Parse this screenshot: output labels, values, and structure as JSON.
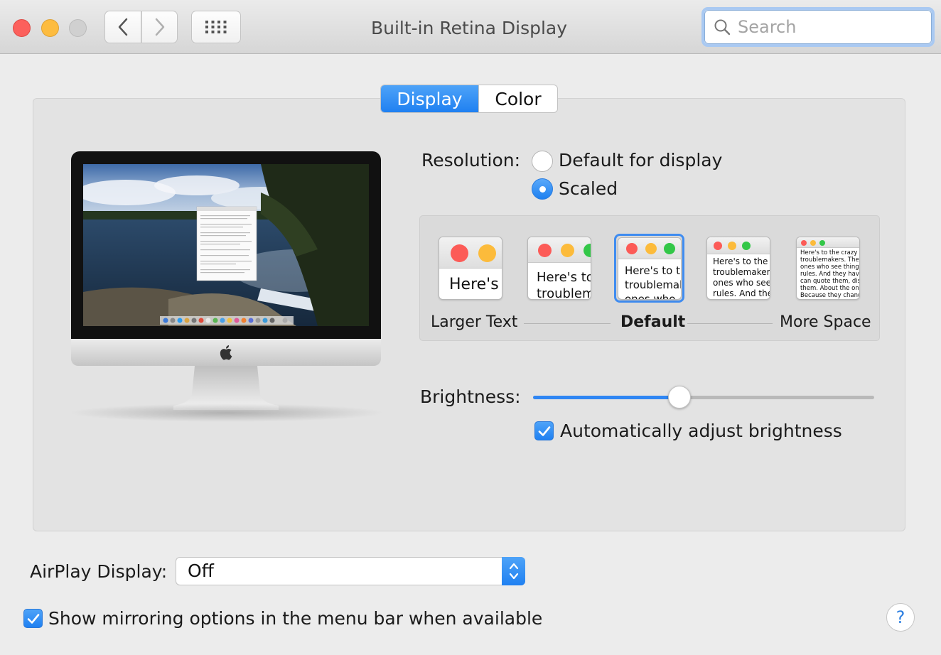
{
  "window": {
    "title": "Built-in Retina Display",
    "search_placeholder": "Search"
  },
  "tabs": [
    {
      "label": "Display",
      "selected": true
    },
    {
      "label": "Color",
      "selected": false
    }
  ],
  "resolution": {
    "label": "Resolution:",
    "options": [
      {
        "label": "Default for display",
        "selected": false
      },
      {
        "label": "Scaled",
        "selected": true
      }
    ]
  },
  "scaling": {
    "options": [
      {
        "sample_text": [
          "Here's"
        ]
      },
      {
        "sample_text": [
          "Here's to",
          "troublem"
        ]
      },
      {
        "sample_text": [
          "Here's to th",
          "troublemak",
          "ones who"
        ],
        "selected": true
      },
      {
        "sample_text": [
          "Here's to the cr",
          "troublemakers. T",
          "ones who see t",
          "rules. And they"
        ]
      },
      {
        "sample_text": [
          "Here's to the crazy one",
          "troublemakers. The rou",
          "ones who see things di",
          "rules. And they have no",
          "can quote them, disagr",
          "them. About the only th",
          "Because they change t"
        ]
      }
    ],
    "labels": {
      "left": "Larger Text",
      "center": "Default",
      "right": "More Space"
    }
  },
  "brightness": {
    "label": "Brightness:",
    "level": 0.43,
    "auto_label": "Automatically adjust brightness",
    "auto_checked": true
  },
  "airplay": {
    "label": "AirPlay Display:",
    "value": "Off"
  },
  "mirroring": {
    "label": "Show mirroring options in the menu bar when available",
    "checked": true
  },
  "help_label": "?",
  "colors": {
    "accent": "#1f80f1",
    "close": "#fc605c",
    "minimize": "#fdbc40"
  }
}
